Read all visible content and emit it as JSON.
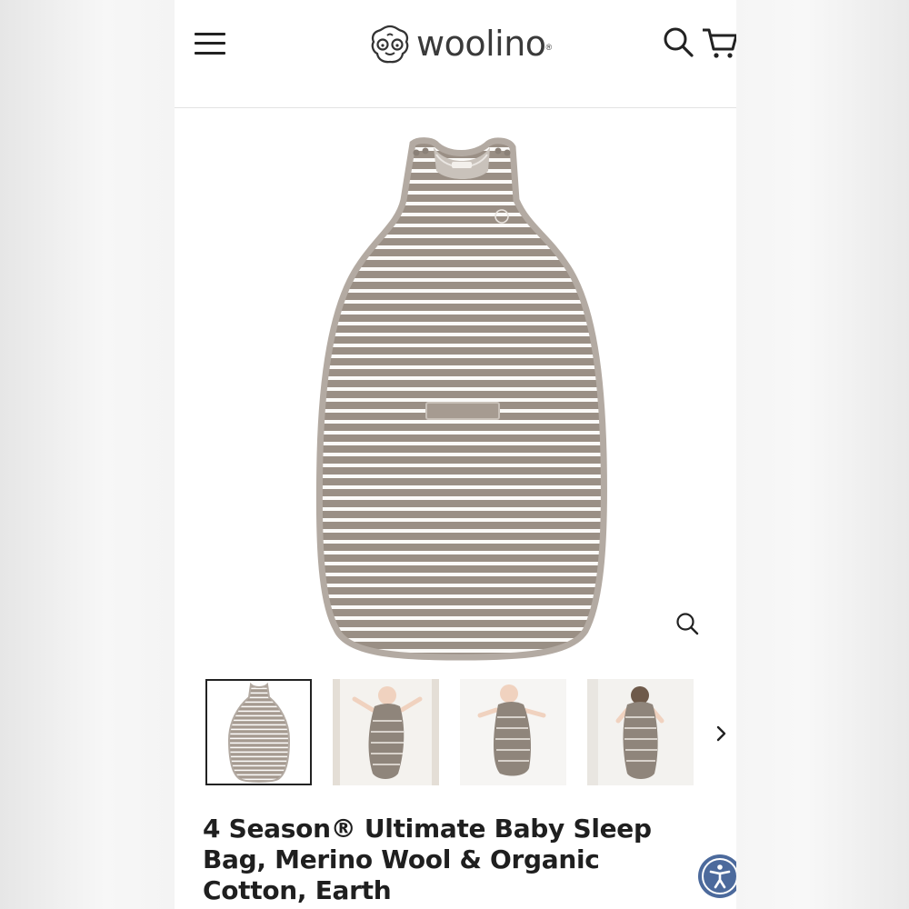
{
  "header": {
    "menu_icon": "hamburger-menu-icon",
    "brand": "woolino",
    "brand_mark": "®",
    "search_icon": "search-icon",
    "cart_icon": "shopping-cart-icon"
  },
  "gallery": {
    "main_image": "striped-sleep-bag-earth",
    "zoom_icon": "zoom-icon",
    "thumbnails": [
      {
        "name": "sleep-bag-flat",
        "active": true
      },
      {
        "name": "baby-in-sleep-bag-1",
        "active": false
      },
      {
        "name": "baby-in-sleep-bag-2",
        "active": false
      },
      {
        "name": "baby-in-sleep-bag-3",
        "active": false
      }
    ],
    "next_icon": "chevron-right-icon"
  },
  "product": {
    "title": "4 Season® Ultimate Baby Sleep Bag, Merino Wool & Organic Cotton, Earth"
  },
  "accessibility_icon": "accessibility-icon",
  "colors": {
    "stripe": "#9a8f85",
    "stripe_light": "#ffffff",
    "trim": "#b3aaa2",
    "accessibility_bg": "#4c6a9c",
    "text": "#1f1f1f"
  }
}
